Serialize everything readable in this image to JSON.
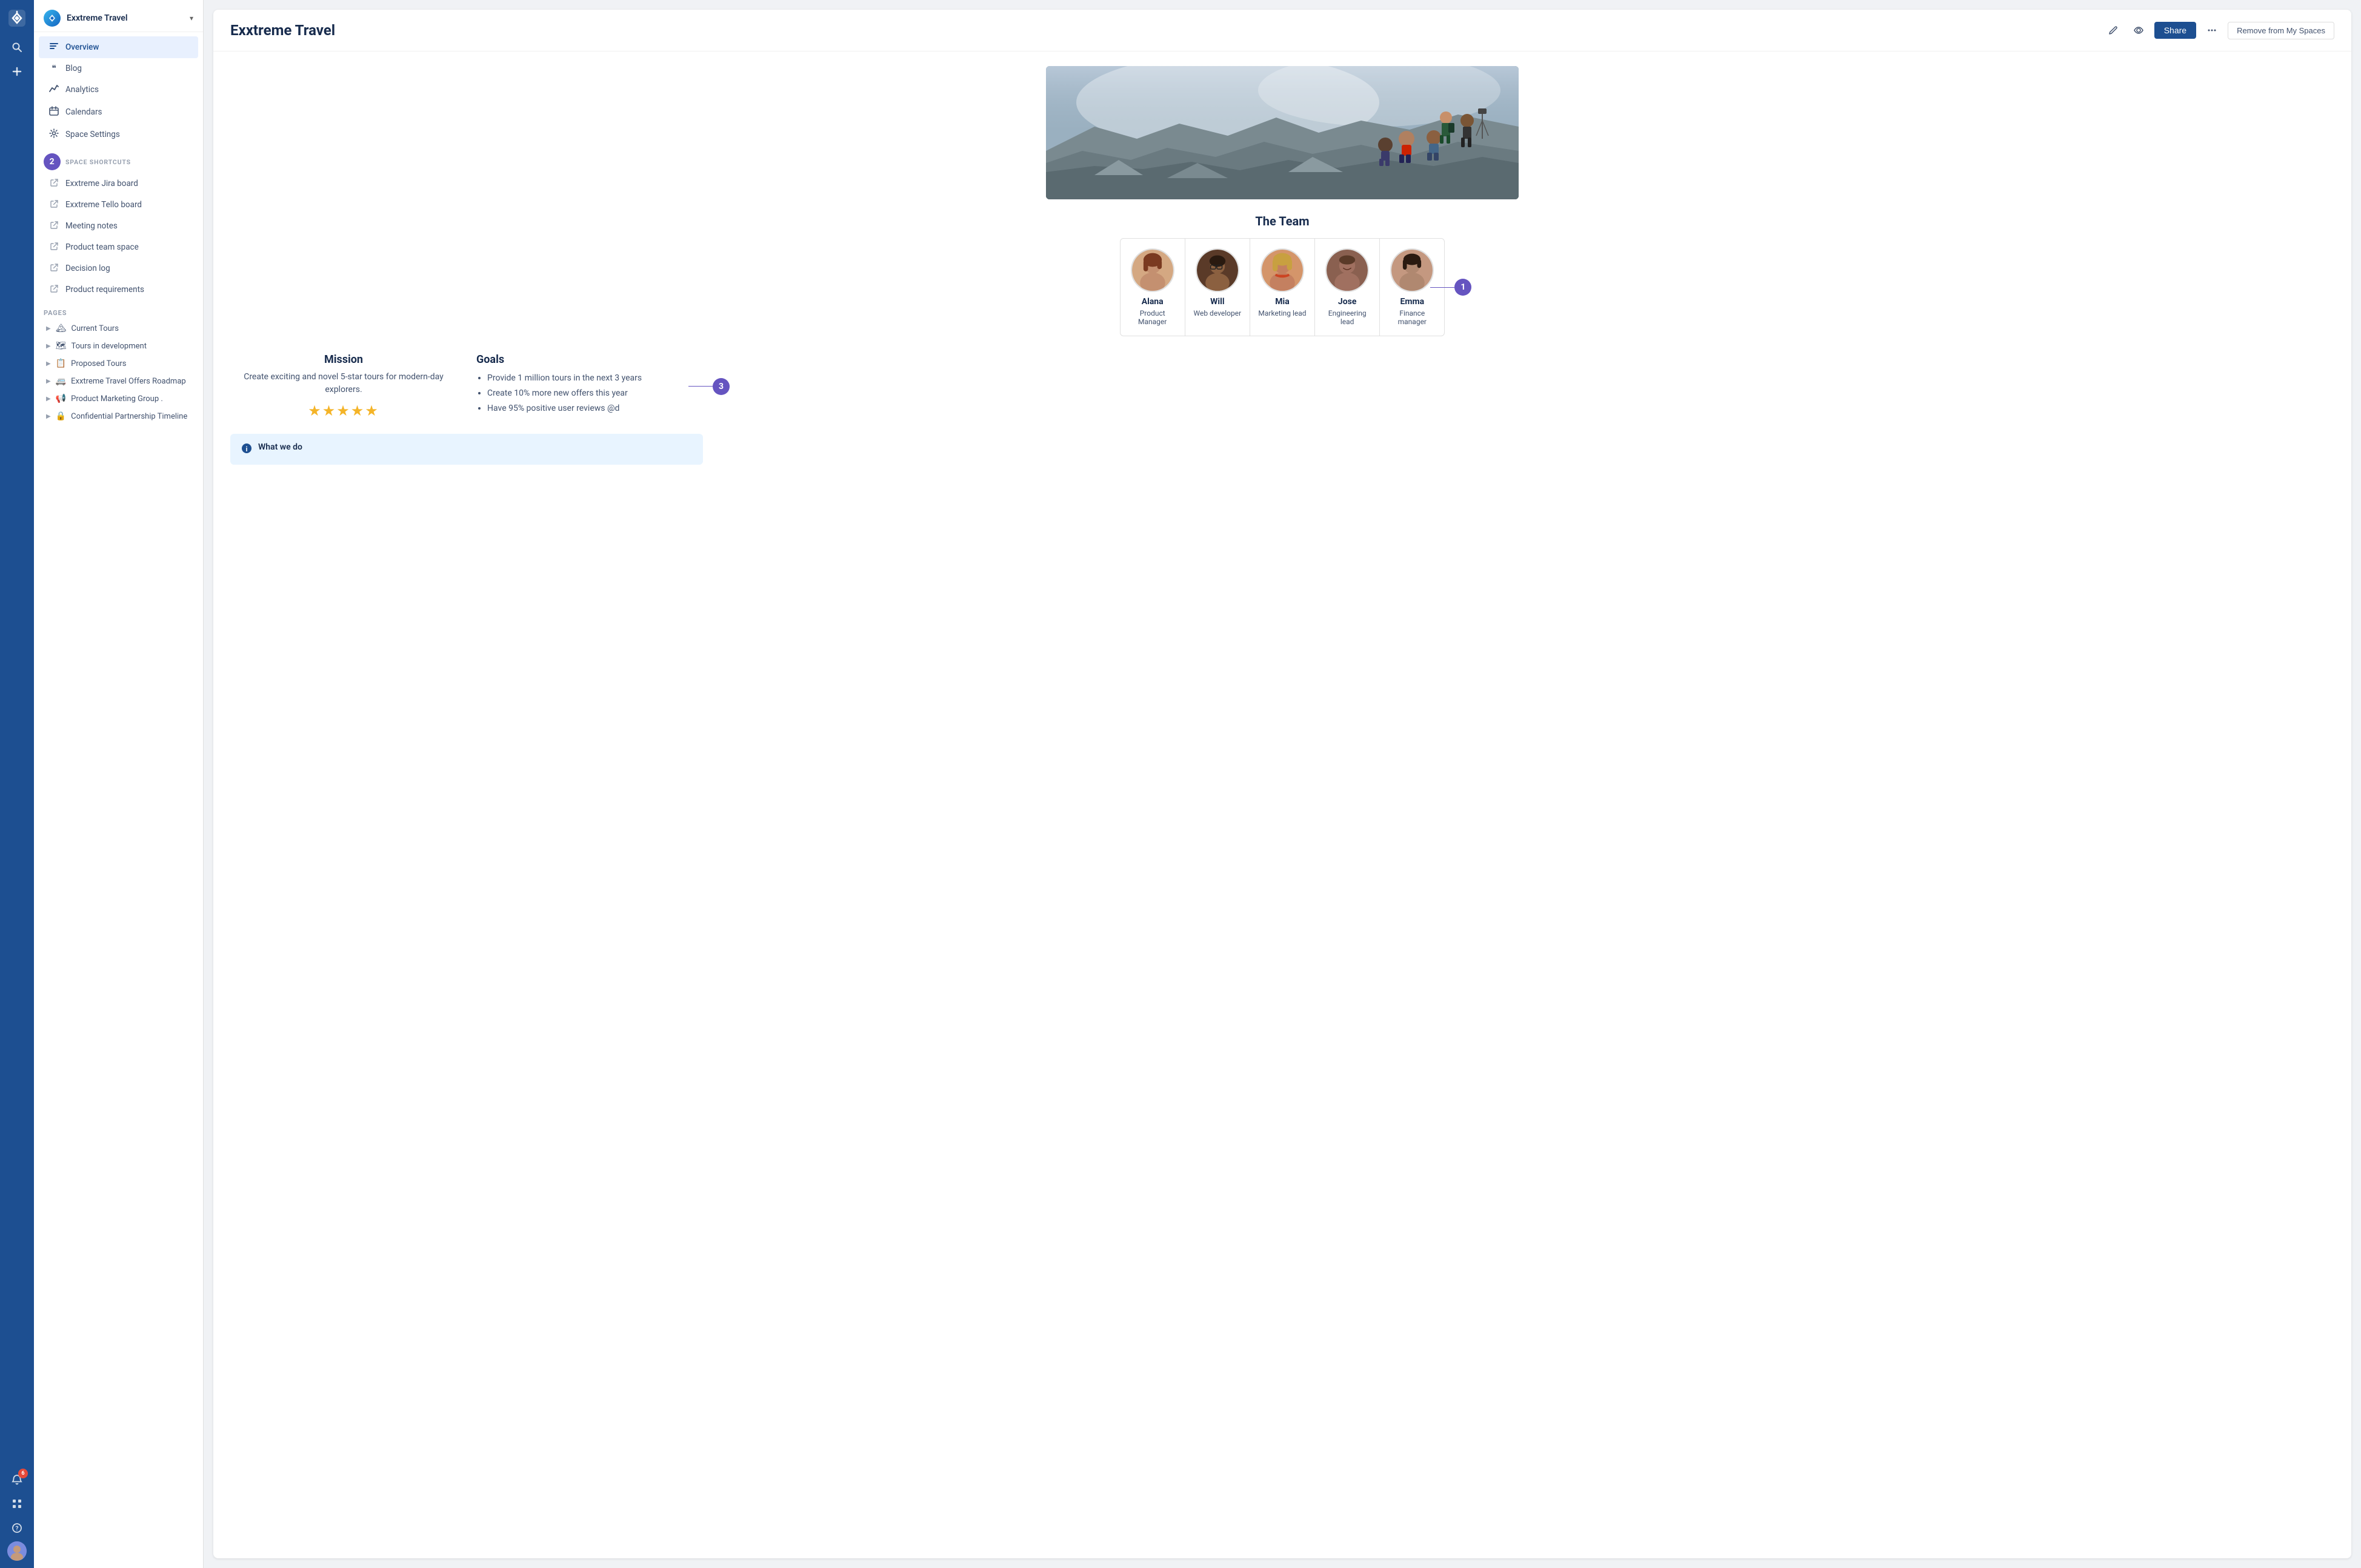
{
  "app": {
    "title": "Exxtreme Travel",
    "logo_icon": "✳"
  },
  "iconbar": {
    "search_label": "🔍",
    "add_label": "+",
    "notification_label": "🔔",
    "notification_count": "6",
    "apps_label": "⊞",
    "help_label": "?",
    "avatar_label": "👤"
  },
  "sidebar": {
    "space_name": "Exxtreme Travel",
    "nav_items": [
      {
        "id": "overview",
        "label": "Overview",
        "icon": "≡",
        "active": true
      },
      {
        "id": "blog",
        "label": "Blog",
        "icon": "❝"
      },
      {
        "id": "analytics",
        "label": "Analytics",
        "icon": "〰"
      },
      {
        "id": "calendars",
        "label": "Calendars",
        "icon": "📅"
      },
      {
        "id": "space-settings",
        "label": "Space Settings",
        "icon": "⚙"
      }
    ],
    "shortcuts_label": "SPACE SHORTCUTS",
    "shortcuts_step": "2",
    "shortcuts": [
      {
        "label": "Exxtreme Jira board"
      },
      {
        "label": "Exxtreme Tello board"
      },
      {
        "label": "Meeting notes"
      },
      {
        "label": "Product team space"
      },
      {
        "label": "Decision log"
      },
      {
        "label": "Product requirements"
      }
    ],
    "pages_label": "PAGES",
    "pages": [
      {
        "emoji": "🏔",
        "label": "Current Tours"
      },
      {
        "emoji": "🗺",
        "label": "Tours in development"
      },
      {
        "emoji": "📋",
        "label": "Proposed Tours"
      },
      {
        "emoji": "🚐",
        "label": "Exxtreme Travel Offers Roadmap"
      },
      {
        "emoji": "📢",
        "label": "Product Marketing Group ."
      },
      {
        "emoji": "🔒",
        "label": "Confidential Partnership Timeline"
      }
    ]
  },
  "header": {
    "title": "Exxtreme Travel",
    "share_label": "Share",
    "remove_label": "Remove from My Spaces"
  },
  "content": {
    "team_title": "The Team",
    "team_members": [
      {
        "name": "Alana",
        "role": "Product Manager",
        "color": "#c8956c"
      },
      {
        "name": "Will",
        "role": "Web developer",
        "color": "#5a4035"
      },
      {
        "name": "Mia",
        "role": "Marketing lead",
        "color": "#d4956a"
      },
      {
        "name": "Jose",
        "role": "Engineering lead",
        "color": "#7a5548"
      },
      {
        "name": "Emma",
        "role": "Finance manager",
        "color": "#8b6355"
      }
    ],
    "mission_title": "Mission",
    "mission_text": "Create exciting and novel 5-star tours for modern-day explorers.",
    "stars": "★★★★★",
    "goals_title": "Goals",
    "goals": [
      "Provide 1 million tours in the next 3 years",
      "Create 10% more new offers this year",
      "Have 95% positive user reviews @d"
    ],
    "what_we_do_title": "What we do"
  },
  "annotations": {
    "step1": "1",
    "step2": "2",
    "step3": "3"
  }
}
